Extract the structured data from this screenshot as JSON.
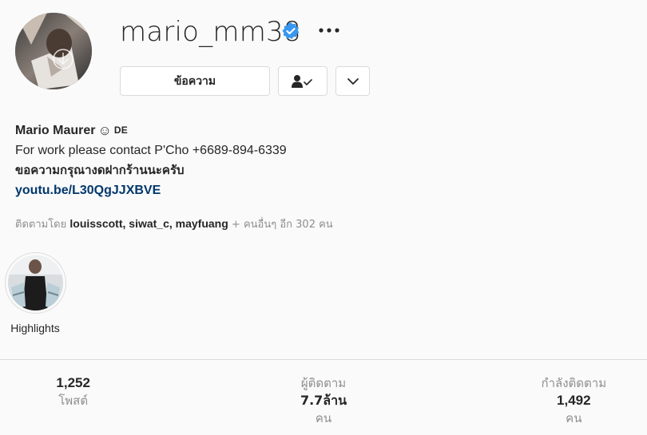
{
  "profile": {
    "username": "mario_mm38",
    "verified_icon": "verified-badge-icon",
    "verified_color": "#3897f0",
    "more_icon": "more-options-icon"
  },
  "actions": {
    "message_label": "ข้อความ",
    "follow_icon": "following-check-icon",
    "dropdown_icon": "chevron-down-icon"
  },
  "bio": {
    "name": "Mario Maurer",
    "name_emoji": "☺",
    "name_suffix": "DE",
    "line1": "For work please contact P'Cho +6689-894-6339",
    "line2": "ขอความกรุณางดฝากร้านนะครับ",
    "link": "youtu.be/L30QgJJXBVE",
    "link_color": "#00376b"
  },
  "followed_by": {
    "prefix": "ติดตามโดย",
    "names": "louisscott, siwat_c, mayfuang",
    "suffix": "+ คนอื่นๆ อีก 302 คน"
  },
  "highlights": [
    {
      "label": "Highlights"
    }
  ],
  "stats": {
    "posts_count": "1,252",
    "posts_label": "โพสต์",
    "followers_label": "ผู้ติดตาม",
    "followers_count": "7.7ล้าน",
    "followers_unit": "คน",
    "following_label": "กำลังติดตาม",
    "following_count": "1,492",
    "following_unit": "คน"
  }
}
